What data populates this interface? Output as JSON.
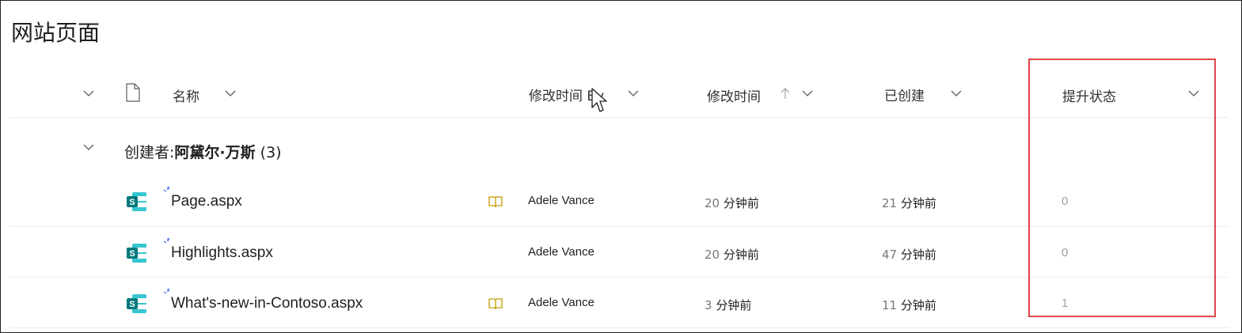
{
  "page": {
    "title": "网站页面"
  },
  "columns": {
    "name": "名称",
    "modified_by": "修改时间 By",
    "modified": "修改时间",
    "created": "已创建",
    "promotion": "提升状态"
  },
  "group": {
    "prefix": "创建者:",
    "name": "阿黛尔·万斯",
    "count": "(3)"
  },
  "rows": [
    {
      "name": "Page.aspx",
      "modified_by": "Adele Vance",
      "modified_num": "20",
      "modified_unit": "分钟前",
      "created_num": "21",
      "created_unit": "分钟前",
      "state": "0",
      "book_icon": true
    },
    {
      "name": "Highlights.aspx",
      "modified_by": "Adele Vance",
      "modified_num": "20",
      "modified_unit": "分钟前",
      "created_num": "47",
      "created_unit": "分钟前",
      "state": "0",
      "book_icon": false
    },
    {
      "name": "What's-new-in-Contoso.aspx",
      "modified_by": "Adele Vance",
      "modified_num": "3",
      "modified_unit": "分钟前",
      "created_num": "11",
      "created_unit": "分钟前",
      "state": "1",
      "book_icon": true
    }
  ],
  "colors": {
    "highlight_border": "#e0474c",
    "sharepoint_teal": "#03787c",
    "book_icon": "#c19c00",
    "new_spark": "#4f6bed"
  },
  "icons": [
    "chevron-down-icon",
    "document-icon",
    "sort-ascending-icon",
    "sharepoint-page-icon",
    "book-icon",
    "mouse-cursor-icon"
  ]
}
